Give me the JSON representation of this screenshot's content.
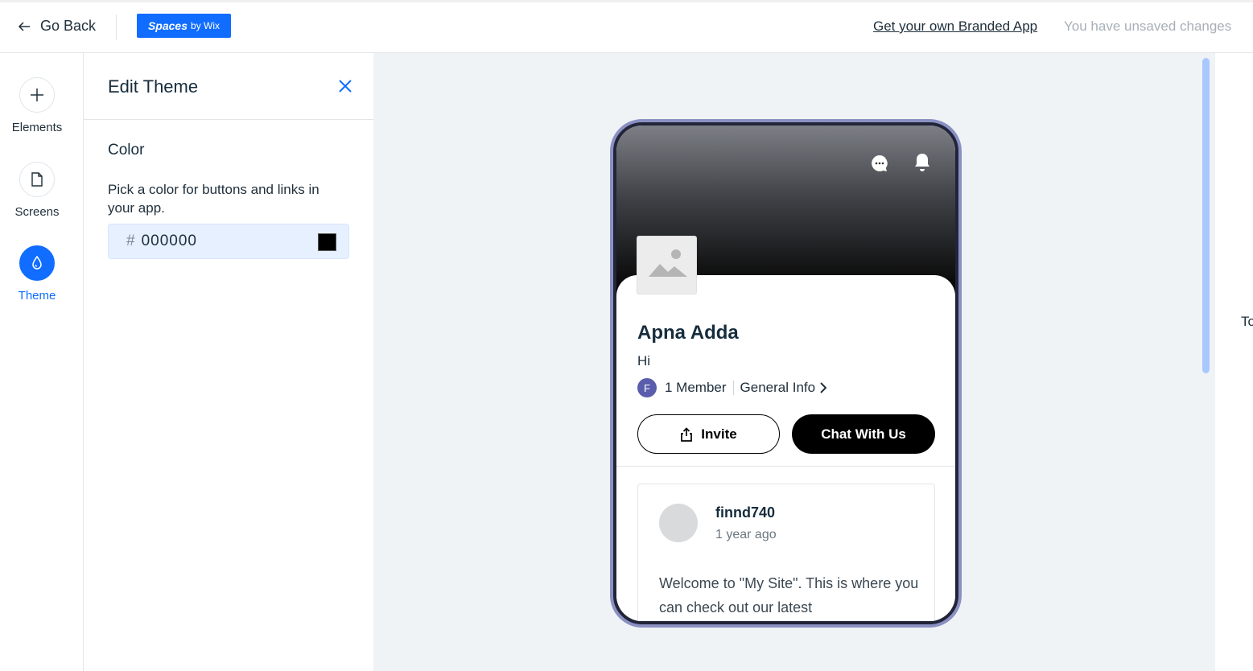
{
  "topbar": {
    "go_back": "Go Back",
    "brand_main": "Spaces",
    "brand_sub": "by Wix",
    "branded_app_link": "Get your own Branded App",
    "unsaved_status": "You have unsaved changes"
  },
  "rail": {
    "items": [
      {
        "label": "Elements",
        "icon": "plus-icon"
      },
      {
        "label": "Screens",
        "icon": "document-icon"
      },
      {
        "label": "Theme",
        "icon": "droplet-icon",
        "active": true
      }
    ]
  },
  "panel": {
    "title": "Edit Theme",
    "section_title": "Color",
    "section_desc": "Pick a color for buttons and links in your app.",
    "hash": "#",
    "hex_value": "000000",
    "swatch_color": "#000000"
  },
  "preview": {
    "group_name": "Apna Adda",
    "description": "Hi",
    "member_initial": "F",
    "member_count": "1 Member",
    "general_info": "General Info",
    "invite_label": "Invite",
    "chat_label": "Chat With Us",
    "post": {
      "author": "finnd740",
      "time": "1 year ago",
      "text": "Welcome to \"My Site\". This is where you can check out our latest"
    }
  },
  "canvas": {
    "right_cut_text": "To"
  },
  "colors": {
    "accent": "#116dff",
    "canvas_bg": "#f0f3f6",
    "phone_frame": "#22253a",
    "member_avatar": "#5a5dab"
  }
}
